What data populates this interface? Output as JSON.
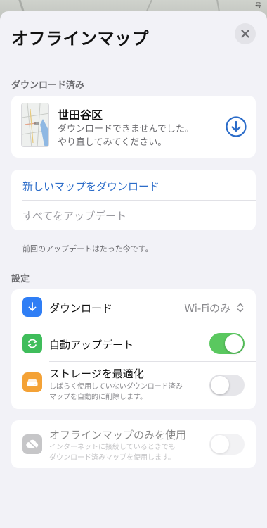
{
  "map_corner_label": "号",
  "sheet": {
    "title": "オフラインマップ",
    "close_label": "✕"
  },
  "downloaded_section": {
    "label": "ダウンロード済み",
    "item": {
      "name": "世田谷区",
      "error_line1": "ダウンロードできませんでした。",
      "error_line2": "やり直してみてください。"
    }
  },
  "actions": {
    "new_download": "新しいマップをダウンロード",
    "update_all": "すべてをアップデート"
  },
  "last_update_note": "前回のアップデートはたった今です。",
  "settings_section": {
    "label": "設定",
    "download": {
      "label": "ダウンロード",
      "value": "Wi-Fiのみ"
    },
    "auto_update": {
      "label": "自動アップデート",
      "enabled": true
    },
    "optimize_storage": {
      "label": "ストレージを最適化",
      "sub_line1": "しばらく使用していないダウンロード済み",
      "sub_line2": "マップを自動的に削除します。",
      "enabled": false
    }
  },
  "offline_only": {
    "label": "オフラインマップのみを使用",
    "sub_line1": "インターネットに接続しているときでも",
    "sub_line2": "ダウンロード済みマップを使用します。",
    "enabled": false
  },
  "colors": {
    "accent_blue": "#2b6cc9",
    "toggle_green": "#5ac85f",
    "download_icon_bg": "#2f7ef5",
    "auto_update_icon_bg": "#3fbd5b",
    "storage_icon_bg": "#f4a236",
    "offline_icon_bg": "#8e8e93"
  }
}
